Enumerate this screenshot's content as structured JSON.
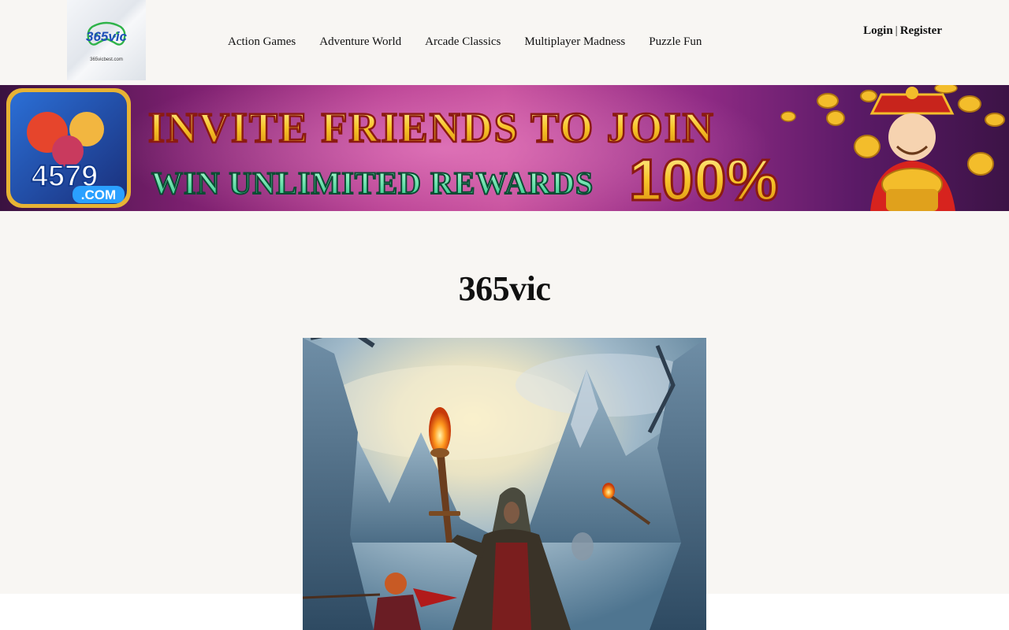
{
  "header": {
    "logo": {
      "brand": "365vic",
      "domain": "365vicbest.com"
    },
    "nav": [
      {
        "label": "Action Games"
      },
      {
        "label": "Adventure World"
      },
      {
        "label": "Arcade Classics"
      },
      {
        "label": "Multiplayer Madness"
      },
      {
        "label": "Puzzle Fun"
      }
    ],
    "auth": {
      "login": "Login",
      "separator": "|",
      "register": "Register"
    }
  },
  "banner": {
    "badge_number": "4579",
    "badge_domain": ".COM",
    "headline": "INVITE FRIENDS TO JOIN",
    "subline": "WIN UNLIMITED REWARDS",
    "percent": "100%",
    "colors": {
      "headline": "#f7c52a",
      "subline": "#3fe0a0",
      "outline": "#8b1a12"
    }
  },
  "main": {
    "title": "365vic"
  },
  "colors": {
    "page_bg": "#f8f6f3",
    "text": "#111111"
  }
}
